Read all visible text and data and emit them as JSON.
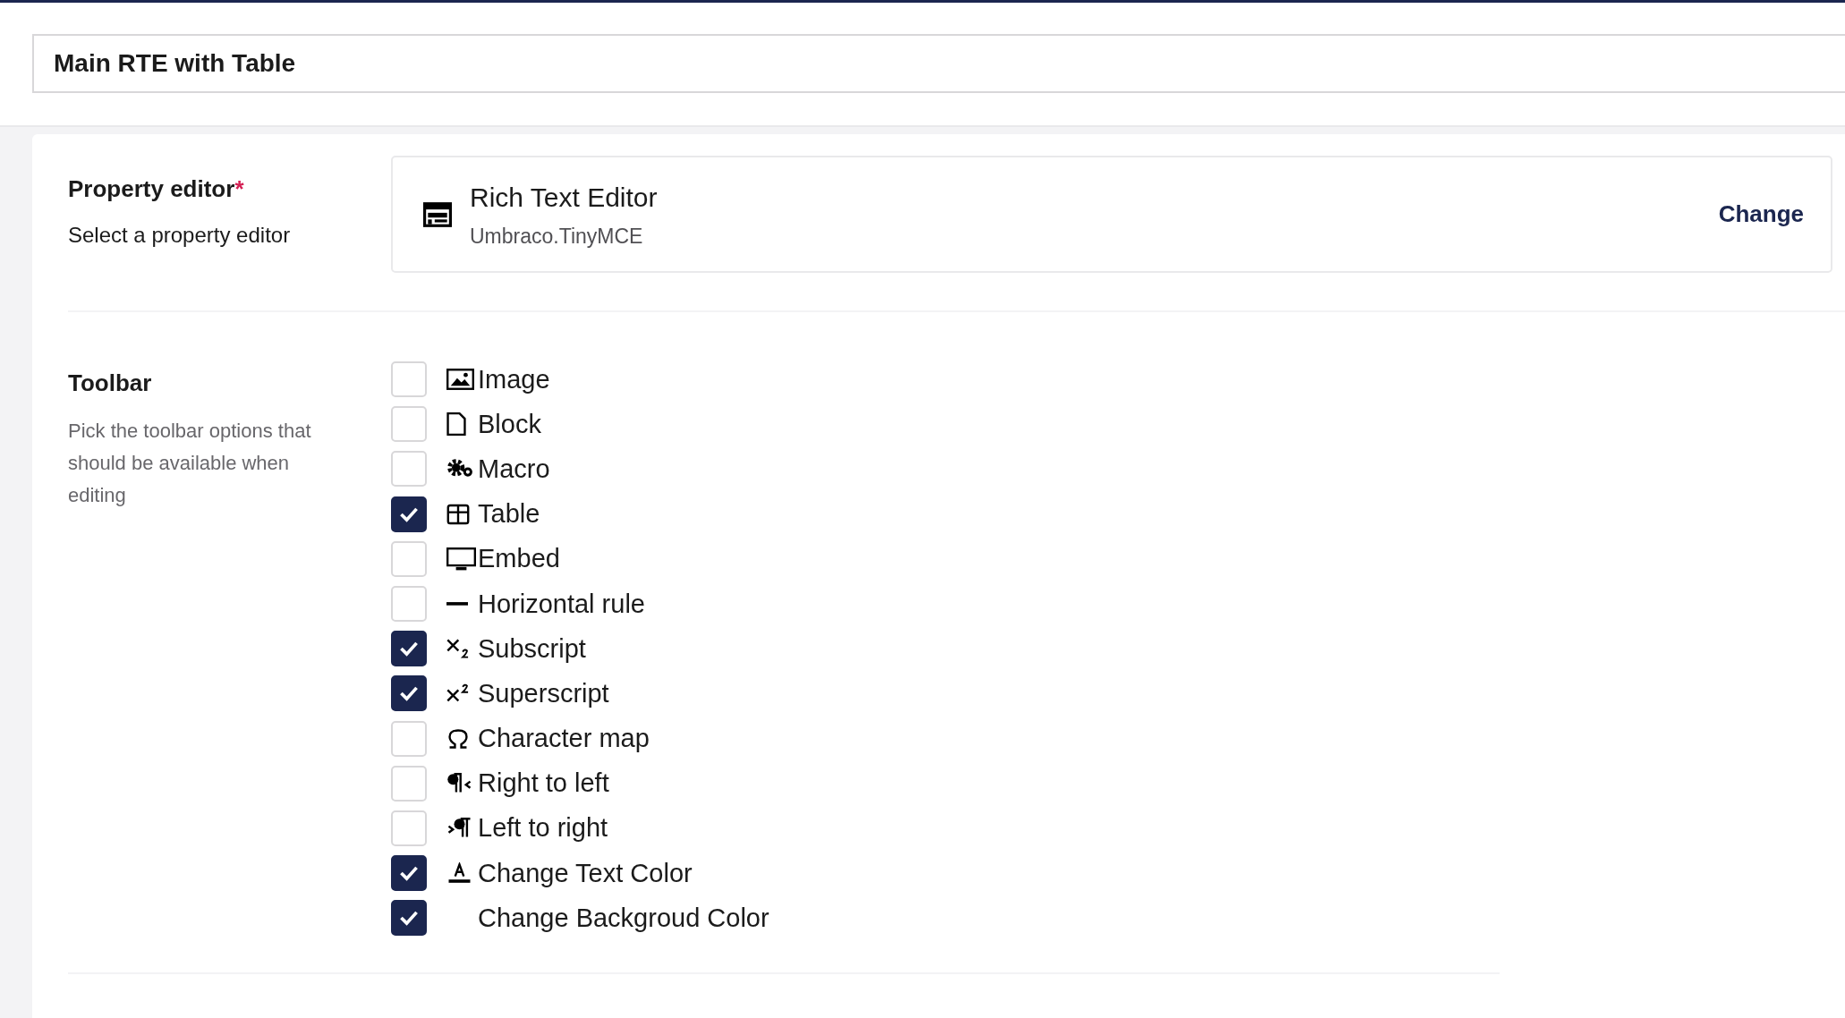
{
  "header": {
    "name_value": "Main RTE with Table"
  },
  "property_editor": {
    "label": "Property editor",
    "required_mark": "*",
    "description": "Select a property editor",
    "editor_name": "Rich Text Editor",
    "editor_alias": "Umbraco.TinyMCE",
    "change_link": "Change"
  },
  "toolbar": {
    "label": "Toolbar",
    "description": "Pick the toolbar options that should be available when editing",
    "options": [
      {
        "kind": "image",
        "label": "Image",
        "checked": false
      },
      {
        "kind": "block",
        "label": "Block",
        "checked": false
      },
      {
        "kind": "macro",
        "label": "Macro",
        "checked": false
      },
      {
        "kind": "table",
        "label": "Table",
        "checked": true
      },
      {
        "kind": "embed",
        "label": "Embed",
        "checked": false
      },
      {
        "kind": "hr",
        "label": "Horizontal rule",
        "checked": false
      },
      {
        "kind": "subscript",
        "label": "Subscript",
        "checked": true
      },
      {
        "kind": "superscript",
        "label": "Superscript",
        "checked": true
      },
      {
        "kind": "charmap",
        "label": "Character map",
        "checked": false
      },
      {
        "kind": "rtl",
        "label": "Right to left",
        "checked": false
      },
      {
        "kind": "ltr",
        "label": "Left to right",
        "checked": false
      },
      {
        "kind": "forecolor",
        "label": "Change Text Color",
        "checked": true
      },
      {
        "kind": "plain",
        "label": "Change Backgroud Color",
        "checked": true
      }
    ]
  }
}
